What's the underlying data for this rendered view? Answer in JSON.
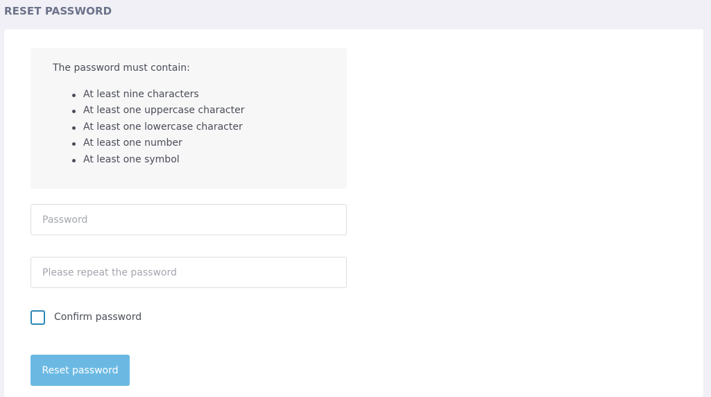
{
  "page": {
    "title": "RESET PASSWORD"
  },
  "rules": {
    "intro": "The password must contain:",
    "items": [
      "At least nine characters",
      "At least one uppercase character",
      "At least one lowercase character",
      "At least one number",
      "At least one symbol"
    ]
  },
  "form": {
    "password_placeholder": "Password",
    "password_value": "",
    "repeat_placeholder": "Please repeat the password",
    "repeat_value": "",
    "confirm_label": "Confirm password",
    "confirm_checked": false,
    "submit_label": "Reset password"
  },
  "colors": {
    "background": "#f0f0f6",
    "title": "#6b7289",
    "checkbox_border": "#2b87b8",
    "button": "#6bb9e3"
  }
}
